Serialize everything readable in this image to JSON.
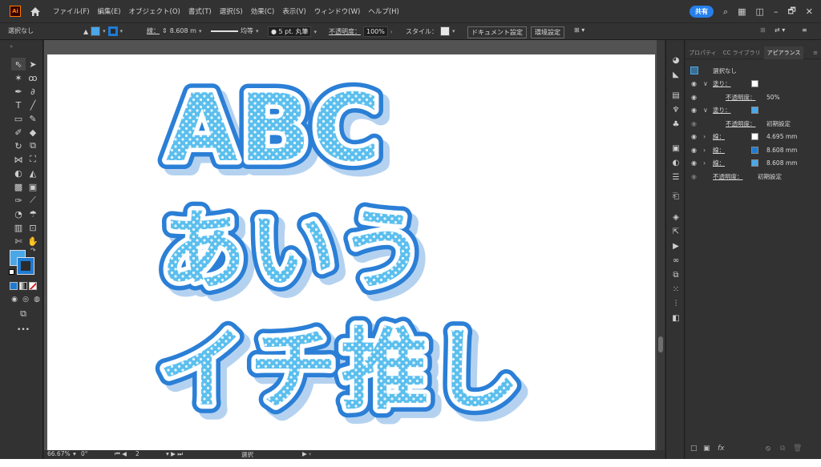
{
  "app": {
    "logo_text": "Ai"
  },
  "menu": [
    "ファイル(F)",
    "編集(E)",
    "オブジェクト(O)",
    "書式(T)",
    "選択(S)",
    "効果(C)",
    "表示(V)",
    "ウィンドウ(W)",
    "ヘルプ(H)"
  ],
  "titlebar": {
    "share_label": "共有",
    "min": "–",
    "max": "🗗",
    "close": "✕"
  },
  "control": {
    "selection": "選択なし",
    "stroke_label": "線：",
    "stroke_value": "8.608 m",
    "profile_label": "均等",
    "brush_label": "5 pt. 丸筆",
    "opacity_label": "不透明度：",
    "opacity_value": "100%",
    "style_label": "スタイル：",
    "doc_settings": "ドキュメント設定",
    "prefs": "環境設定"
  },
  "colors": {
    "fill": "#4aa7e8",
    "stroke": "#1e7bd4",
    "text_fill": "#5bbfee",
    "outer_stroke": "#2b7fd6"
  },
  "artwork": {
    "line1": "ABC",
    "line2": "あいう",
    "line3": "イチ推し"
  },
  "panel": {
    "tabs": [
      "プロパティ",
      "CC ライブラリ",
      "アピアランス"
    ],
    "active_tab": "アピアランス",
    "header": "選択なし",
    "rows": [
      {
        "label": "塗り：",
        "chev": "∨",
        "swatch": "#ffffff",
        "value": ""
      },
      {
        "label": "不透明度：",
        "chev": "",
        "swatch": "",
        "value": "50%"
      },
      {
        "label": "塗り：",
        "chev": "∨",
        "swatch": "#4aa7e8",
        "value": ""
      },
      {
        "label": "不透明度：",
        "chev": "",
        "swatch": "",
        "value": "初期設定"
      },
      {
        "label": "線：",
        "chev": "›",
        "swatch": "#ffffff",
        "value": "4.695 mm"
      },
      {
        "label": "線：",
        "chev": "›",
        "swatch": "#1e7bd4",
        "value": "8.608 mm"
      },
      {
        "label": "線：",
        "chev": "›",
        "swatch": "#4aa7e8",
        "value": "8.608 mm"
      },
      {
        "label": "不透明度：",
        "chev": "",
        "swatch": "",
        "value": "初期設定"
      }
    ]
  },
  "status": {
    "zoom": "66.67%",
    "rotate": "0°",
    "artboard": "2",
    "tool": "選択"
  }
}
